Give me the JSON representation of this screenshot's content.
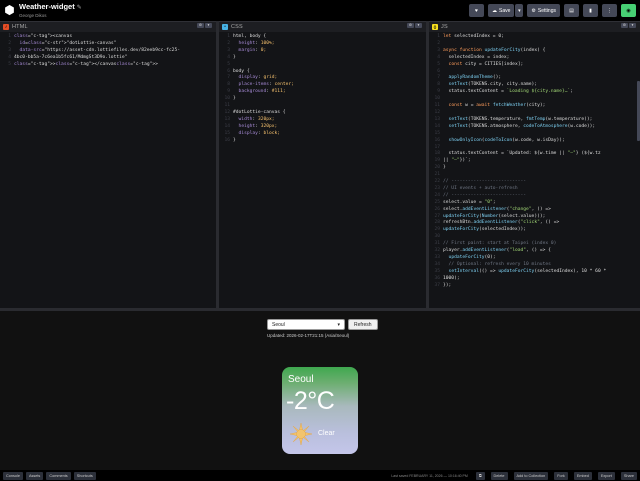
{
  "app": {
    "title": "Weather-widget",
    "author": "George Dikos"
  },
  "toolbar": {
    "heart_label": "♥",
    "save_label": "Save",
    "settings_label": "Settings"
  },
  "editors": {
    "html": {
      "name": "HTML",
      "lines": [
        "<canvas",
        "  id=\"dotLottie-canvas\"",
        "  data-src=\"https://asset-cdn.lottiefiles.dev/82eeb9cc-fc25-",
        "4bc0-bb5a-7c6ea1b5fc61/MdmgSt3D9o.lottie\"",
        "></canvas>"
      ]
    },
    "css": {
      "name": "CSS",
      "lines": [
        "html, body {",
        "  height: 100%;",
        "  margin: 0;",
        "}",
        "",
        "body {",
        "  display: grid;",
        "  place-items: center;",
        "  background: #111;",
        "}",
        "",
        "#dotLottie-canvas {",
        "  width: 320px;",
        "  height: 320px;",
        "  display: block;",
        "}"
      ]
    },
    "js": {
      "name": "JS",
      "lines": [
        "let selectedIndex = 0;",
        "",
        "async function updateForCity(index) {",
        "  selectedIndex = index;",
        "  const city = CITIES[index];",
        "",
        "  applyRandomTheme();",
        "  setText(TOKENS.city, city.name);",
        "  status.textContent = `Loading ${city.name}…`;",
        "",
        "  const w = await fetchWeather(city);",
        "",
        "  setText(TOKENS.temperature, fmtTemp(w.temperature));",
        "  setText(TOKENS.atmosphere, codeToAtmosphere(w.code));",
        "",
        "  showOnlyIcon(codeToIcon(w.code, w.isDay));",
        "",
        "  status.textContent = `Updated: ${w.time || \"—\"} (${w.tz",
        "|| \"—\"})`;",
        "}",
        "",
        "// ---------------------------",
        "// UI events + auto-refresh",
        "// ---------------------------",
        "select.value = \"0\";",
        "select.addEventListener(\"change\", () =>",
        "updateForCity(Number(select.value)));",
        "refreshBtn.addEventListener(\"click\", () =>",
        "updateForCity(selectedIndex));",
        "",
        "// First paint: start at Taipei (index 0)",
        "player.addEventListener(\"load\", () => {",
        "  updateForCity(0);",
        "  // Optional: refresh every 10 minutes",
        "  setInterval(() => updateForCity(selectedIndex), 10 * 60 *",
        "1000);",
        "});"
      ]
    }
  },
  "preview": {
    "city_selected": "Seoul",
    "refresh_label": "Refresh",
    "status": "Updated: 2026-02-17T21:15 (Asia/Seoul)",
    "widget": {
      "city": "Seoul",
      "temperature": "-2°C",
      "description": "Clear"
    }
  },
  "bottombar": {
    "left": [
      "Console",
      "Assets",
      "Comments",
      "Shortcuts"
    ],
    "saved": "Last saved FEBRUARY 11, 2026 — 10:16:40 PM",
    "right": [
      "Delete",
      "Add to Collection",
      "Fork",
      "Embed",
      "Export",
      "Share"
    ]
  },
  "colors": {
    "html_badge": "#e44d26",
    "css_badge": "#47b3e5",
    "js_badge": "#f7df1e",
    "accent": "#47cf73"
  }
}
